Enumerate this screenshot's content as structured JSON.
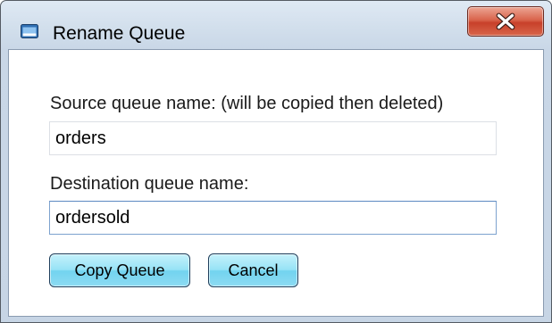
{
  "window": {
    "title": "Rename Queue",
    "title_icon": "window-app-icon",
    "close_icon": "close-x-icon"
  },
  "form": {
    "source_label": "Source queue name: (will be copied then deleted)",
    "source_value": "orders",
    "destination_label": "Destination queue name:",
    "destination_value": "ordersold"
  },
  "buttons": {
    "copy_label": "Copy Queue",
    "cancel_label": "Cancel"
  },
  "colors": {
    "button_fill": "#8ddbf3",
    "close_button_fill": "#d9644c",
    "focused_input_border": "#7da2ce"
  }
}
